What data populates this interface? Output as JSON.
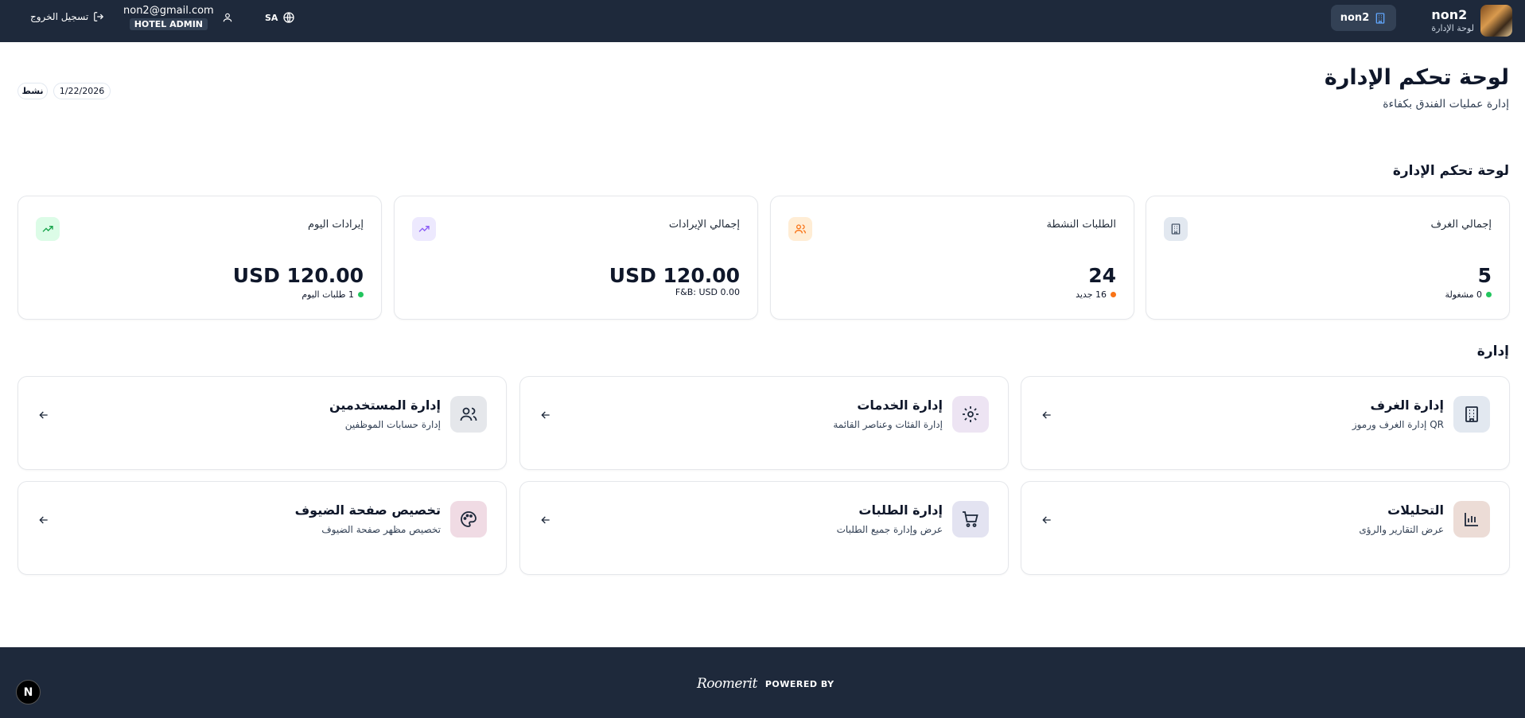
{
  "header": {
    "brand_name": "non2",
    "brand_subtitle": "لوحة الإدارة",
    "hotel_button": "non2",
    "language": "SA",
    "user_email": "non2@gmail.com",
    "user_role": "HOTEL ADMIN",
    "logout_label": "تسجيل الخروج"
  },
  "page": {
    "title": "لوحة تحكم الإدارة",
    "subtitle": "إدارة عمليات الفندق بكفاءة",
    "date": "1/22/2026",
    "status": "نشط"
  },
  "stats_section": {
    "title": "لوحة تحكم الإدارة",
    "cards": [
      {
        "label": "إجمالي الغرف",
        "value": "5",
        "sub": "0 مشغولة",
        "dot_color": "#22c55e",
        "icon": "building-icon",
        "icon_bg": "#e2e8f0"
      },
      {
        "label": "الطلبات النشطة",
        "value": "24",
        "sub": "16 جديد",
        "dot_color": "#f97316",
        "icon": "users-icon",
        "icon_bg": "#ffedd5"
      },
      {
        "label": "إجمالي الإيرادات",
        "value": "USD 120.00",
        "sub": "F&B: USD 0.00",
        "icon": "trend-icon",
        "icon_bg": "#ede9fe"
      },
      {
        "label": "إيرادات اليوم",
        "value": "USD 120.00",
        "sub": "1 طلبات اليوم",
        "dot_color": "#22c55e",
        "icon": "trend-icon",
        "icon_bg": "#dcfce7"
      }
    ]
  },
  "manage_section": {
    "title": "إدارة",
    "cards": [
      {
        "title": "إدارة الغرف",
        "desc": "إدارة الغرف ورموز QR",
        "icon": "building-icon",
        "icon_bg": "#e2e8f0"
      },
      {
        "title": "إدارة الخدمات",
        "desc": "إدارة الفئات وعناصر القائمة",
        "icon": "gear-icon",
        "icon_bg": "#ede4f3"
      },
      {
        "title": "إدارة المستخدمين",
        "desc": "إدارة حسابات الموظفين",
        "icon": "users-icon",
        "icon_bg": "#e5e7eb"
      },
      {
        "title": "التحليلات",
        "desc": "عرض التقارير والرؤى",
        "icon": "bar-chart-icon",
        "icon_bg": "#ecdcd6"
      },
      {
        "title": "إدارة الطلبات",
        "desc": "عرض وإدارة جميع الطلبات",
        "icon": "cart-icon",
        "icon_bg": "#e3e3f1"
      },
      {
        "title": "تخصيص صفحة الضيوف",
        "desc": "تخصيص مظهر صفحة الضيوف",
        "icon": "palette-icon",
        "icon_bg": "#f0dbe4"
      }
    ]
  },
  "footer": {
    "powered_by": "POWERED BY",
    "logo_text": "Roomerit"
  },
  "dev_badge": "N"
}
